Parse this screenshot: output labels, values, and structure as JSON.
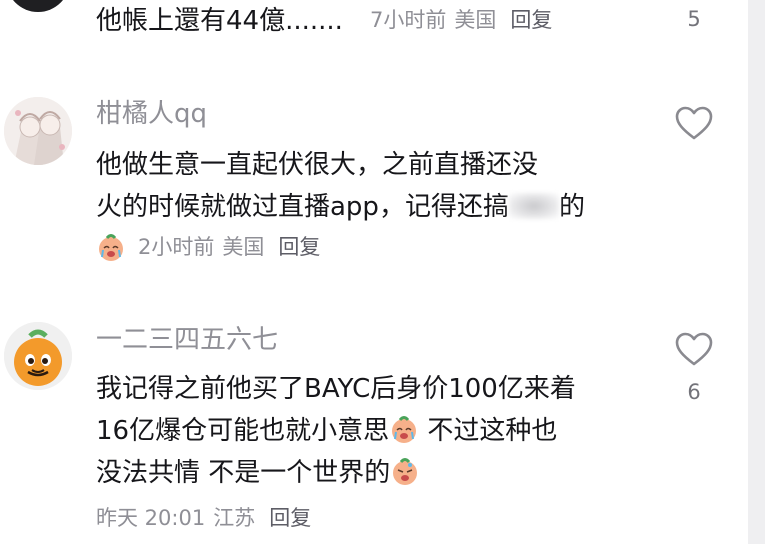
{
  "comments": [
    {
      "text": "他帳上還有44億.......",
      "time": "7小时前",
      "location": "美国",
      "reply": "回复",
      "likes": "5",
      "avatar_icon": "dark-avatar-icon"
    },
    {
      "username": "柑橘人qq",
      "line1": "他做生意一直起伏很大，之前直播还没",
      "line2a": "火的时候就做过直播app，记得还搞",
      "line2b": "的",
      "emoji": "crying-peach-emoji",
      "time": "2小时前",
      "location": "美国",
      "reply": "回复",
      "avatar_icon": "anime-couple-avatar-icon"
    },
    {
      "username": "一二三四五六七",
      "line1": "我记得之前他买了BAYC后身价100亿来着",
      "line2a": "16亿爆仓可能也就小意思",
      "line2b": " 不过这种也",
      "line3a": "没法共情  不是一个世界的",
      "time": "昨天 20:01",
      "location": "江苏",
      "reply": "回复",
      "likes": "6",
      "avatar_icon": "orange-fruit-avatar-icon"
    }
  ],
  "colors": {
    "text": "#16161a",
    "muted": "#8f8f96",
    "reply": "#5d5d66",
    "scrollbar": "#efeff1"
  }
}
